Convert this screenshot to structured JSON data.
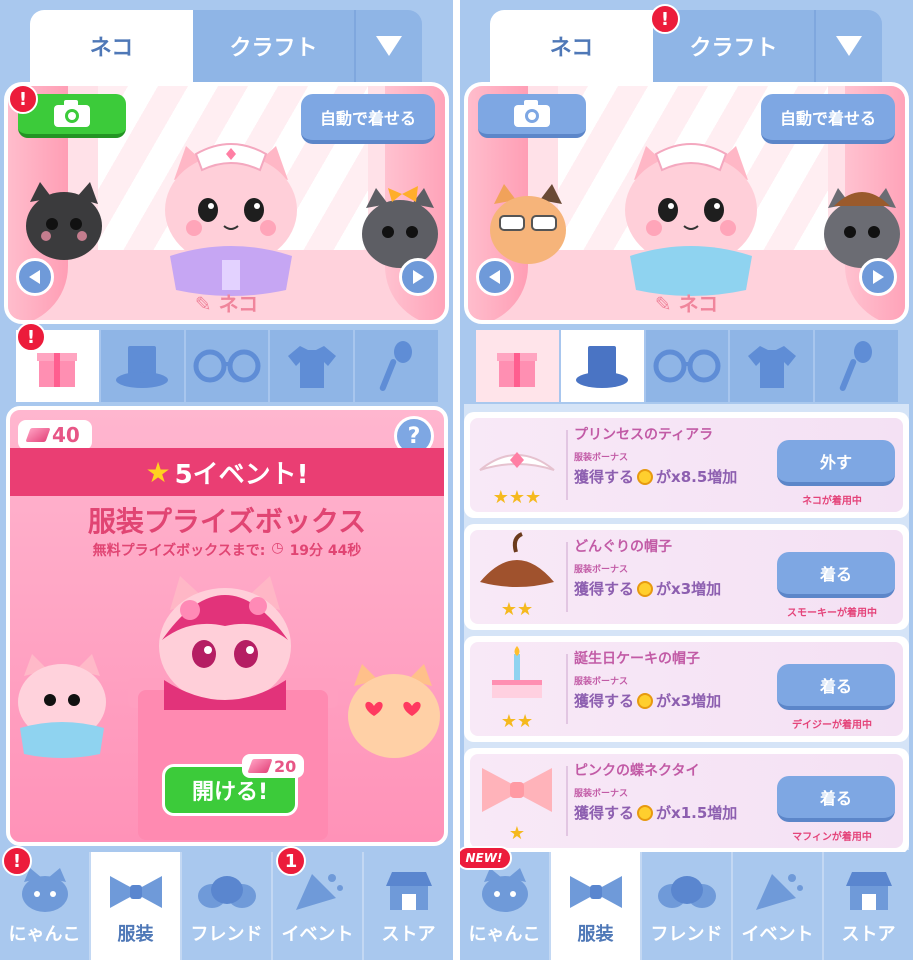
{
  "left": {
    "tabs": {
      "cat": "ネコ",
      "craft": "クラフト"
    },
    "stage": {
      "auto_dress": "自動で着せる",
      "cat_name": "ネコ"
    },
    "badges": {
      "camera": "!",
      "gift": "!",
      "nyanko": "!",
      "event": "1"
    },
    "event": {
      "gems": "40",
      "help": "?",
      "banner_star": "★",
      "banner": "5イベント!",
      "title": "服装プライズボックス",
      "countdown_label": "無料プライズボックスまで:",
      "countdown_time": "19分 44秒",
      "open_button": "開ける!",
      "cost": "20"
    }
  },
  "right": {
    "tabs": {
      "cat": "ネコ",
      "craft": "クラフト"
    },
    "stage": {
      "auto_dress": "自動で着せる",
      "cat_name": "ネコ"
    },
    "badges": {
      "craft": "!",
      "new": "NEW!"
    },
    "items": [
      {
        "name": "プリンセスのティアラ",
        "sub": "服装ボーナス",
        "bonus_pre": "獲得する",
        "bonus_post": "がx8.5増加",
        "stars": "★★★",
        "button": "外す",
        "wearer": "ネコが着用中"
      },
      {
        "name": "どんぐりの帽子",
        "sub": "服装ボーナス",
        "bonus_pre": "獲得する",
        "bonus_post": "がx3増加",
        "stars": "★★",
        "button": "着る",
        "wearer": "スモーキーが着用中"
      },
      {
        "name": "誕生日ケーキの帽子",
        "sub": "服装ボーナス",
        "bonus_pre": "獲得する",
        "bonus_post": "がx3増加",
        "stars": "★★",
        "button": "着る",
        "wearer": "デイジーが着用中"
      },
      {
        "name": "ピンクの蝶ネクタイ",
        "sub": "服装ボーナス",
        "bonus_pre": "獲得する",
        "bonus_post": "がx1.5増加",
        "stars": "★",
        "button": "着る",
        "wearer": "マフィンが着用中"
      }
    ]
  },
  "nav": {
    "nyanko": "にゃんこ",
    "outfit": "服装",
    "friend": "フレンド",
    "event": "イベント",
    "store": "ストア"
  },
  "icons": [
    "camera-icon",
    "chevron-left-icon",
    "chevron-right-icon",
    "gift-icon",
    "top-hat-icon",
    "glasses-icon",
    "shirt-icon",
    "spoon-icon",
    "cat-face-icon",
    "bow-tie-icon",
    "friends-icon",
    "party-popper-icon",
    "store-icon",
    "clock-icon",
    "gem-icon",
    "coin-icon",
    "edit-icon"
  ],
  "colors": {
    "accent_blue": "#7ea7e3",
    "bg_blue": "#a9c8ee",
    "pink": "#ea3e73",
    "green": "#3ccb3a",
    "badge_red": "#ec1c3b",
    "star": "#f5b91e"
  }
}
